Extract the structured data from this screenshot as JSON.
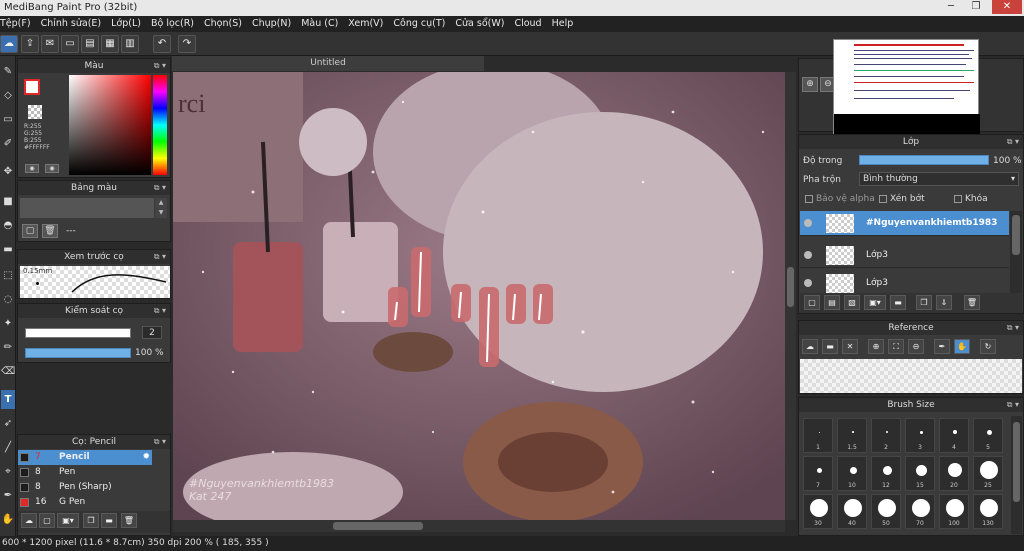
{
  "window": {
    "title": "MediBang Paint Pro (32bit)",
    "btn_min": "─",
    "btn_restore": "❐",
    "btn_close": "✕"
  },
  "menu": [
    "Tệp(F)",
    "Chỉnh sửa(E)",
    "Lớp(L)",
    "Bộ lọc(R)",
    "Chọn(S)",
    "Chụp(N)",
    "Màu (C)",
    "Xem(V)",
    "Công cụ(T)",
    "Cửa sổ(W)",
    "Cloud",
    "Help"
  ],
  "color_panel": {
    "title": "Màu",
    "r": "R:255",
    "g": "G:255",
    "b": "B:255",
    "hex": "#FFFFFF",
    "main_color": "#ffffff"
  },
  "palette_panel": {
    "title": "Bảng màu",
    "value": "---"
  },
  "brush_preview": {
    "title": "Xem trước cọ",
    "size": "0.15mm"
  },
  "brush_control": {
    "title": "Kiểm soát cọ",
    "size_value": "2",
    "opacity_value": "100 %"
  },
  "brush_list": {
    "title": "Cọ: Pencil",
    "items": [
      {
        "size": "7",
        "name": "Pencil",
        "selected": true,
        "color": "#1c1c1c"
      },
      {
        "size": "8",
        "name": "Pen",
        "selected": false,
        "color": "#1c1c1c"
      },
      {
        "size": "8",
        "name": "Pen (Sharp)",
        "selected": false,
        "color": "#1c1c1c"
      },
      {
        "size": "16",
        "name": "G Pen",
        "selected": false,
        "color": "#e02828"
      }
    ]
  },
  "document": {
    "tab_title": "Untitled",
    "watermark_line1": "#Nguyenvankhiemtb1983",
    "watermark_line2": "Kat 247"
  },
  "layer_panel": {
    "title": "Lớp",
    "opacity_label": "Độ trong",
    "opacity_value": "100 %",
    "opacity_fraction": 1.0,
    "blend_label": "Pha trộn",
    "blend_value": "Bình thường",
    "protect_alpha": "Bảo vệ alpha",
    "clipping": "Xén bớt",
    "lock": "Khóa",
    "layers": [
      {
        "name": "#Nguyenvankhiemtb1983",
        "selected": true
      },
      {
        "name": "Lớp3",
        "selected": false
      },
      {
        "name": "Lớp3",
        "selected": false
      }
    ]
  },
  "reference_panel": {
    "title": "Reference"
  },
  "brush_size_panel": {
    "title": "Brush Size",
    "sizes": [
      "1",
      "1.5",
      "2",
      "3",
      "4",
      "5",
      "7",
      "10",
      "12",
      "15",
      "20",
      "25",
      "30",
      "40",
      "50",
      "70",
      "100",
      "130"
    ]
  },
  "status": {
    "text": "600 * 1200 pixel   (11.6 * 8.7cm)   350 dpi   200 %   ( 185, 355 )"
  },
  "colors": {
    "accent": "#4c8fd0",
    "selected_row": "#4c8fd0"
  }
}
